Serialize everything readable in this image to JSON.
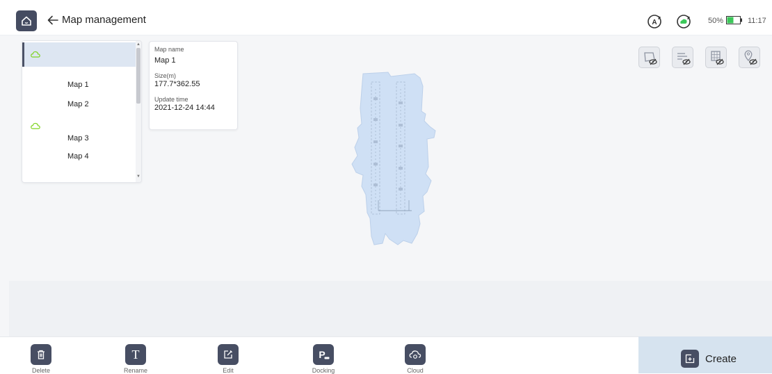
{
  "header": {
    "title": "Map management",
    "battery_percent_label": "50%",
    "battery_level": 0.5,
    "time": "11:17",
    "icons": {
      "home": "home-icon",
      "back": "back-arrow-icon",
      "auto": "auto-mode-icon",
      "sync": "sync-icon",
      "battery": "battery-icon"
    }
  },
  "map_list": {
    "items": [
      {
        "label": "Map 1",
        "cloud": false
      },
      {
        "label": "Map 2",
        "cloud": false
      },
      {
        "label": "Map 3",
        "cloud": true
      },
      {
        "label": "Map 4",
        "cloud": false
      }
    ],
    "cloud_color": "#7ed321"
  },
  "info_card": {
    "name_label": "Map name",
    "name_value": "Map 1",
    "size_label": "Size(m)",
    "size_value": "177.7*362.55",
    "update_label": "Update time",
    "update_value": "2021-12-24 14:44"
  },
  "layer_toggles": [
    {
      "name": "area-layer-hidden-icon"
    },
    {
      "name": "path-layer-hidden-icon"
    },
    {
      "name": "grid-layer-hidden-icon"
    },
    {
      "name": "point-layer-hidden-icon"
    }
  ],
  "toolbar": {
    "delete": "Delete",
    "rename": "Rename",
    "rename_glyph": "T",
    "edit": "Edit",
    "docking": "Docking",
    "docking_glyph": "P",
    "cloud": "Cloud",
    "create": "Create"
  },
  "colors": {
    "accent_dark": "#474e63",
    "selection": "#dde6f2",
    "map_fill": "#cfe0f5",
    "status_green": "#3cc85a"
  }
}
